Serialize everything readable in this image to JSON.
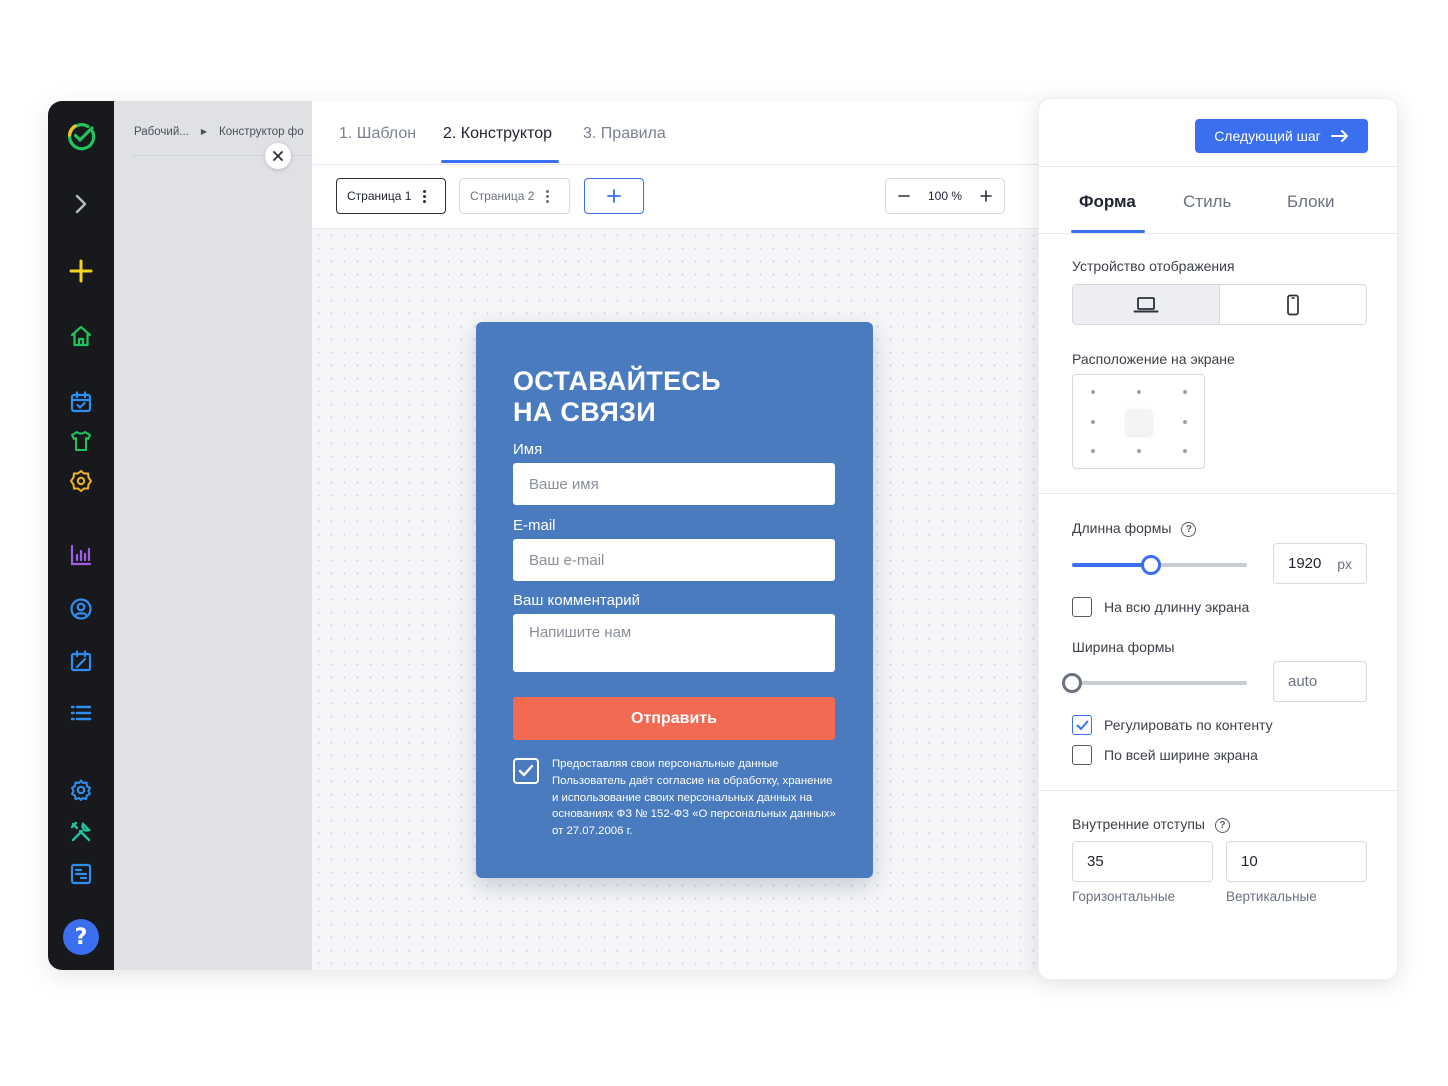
{
  "breadcrumbs": [
    "Рабочий...",
    "Конструктор фо"
  ],
  "steps": [
    {
      "label": "1. Шаблон",
      "active": false
    },
    {
      "label": "2. Конструктор",
      "active": true
    },
    {
      "label": "3. Правила",
      "active": false
    }
  ],
  "toolbar": {
    "pages": [
      "Страница 1",
      "Страница 2"
    ],
    "add_label": "+",
    "zoom": "100 %",
    "zoom_out": "−",
    "zoom_in": "+"
  },
  "form": {
    "title_line1": "ОСТАВАЙТЕСЬ",
    "title_line2": "НА СВЯЗИ",
    "fields": [
      {
        "label": "Имя",
        "placeholder": "Ваше имя"
      },
      {
        "label": "E-mail",
        "placeholder": "Ваш e-mail"
      },
      {
        "label": "Ваш комментарий",
        "placeholder": "Напишите нам"
      }
    ],
    "submit_label": "Отправить",
    "consent_checked": true,
    "consent_text": "Предоставляя свои персональные данные Пользователь даёт согласие на обработку, хранение и использование своих персональных данных на основаниях ФЗ № 152-ФЗ «О персональных данных» от 27.07.2006 г.",
    "colors": {
      "background": "#4a7bbf",
      "button": "#f36a52"
    }
  },
  "panel": {
    "next_label": "Следующий шаг",
    "tabs": [
      {
        "label": "Форма",
        "active": true
      },
      {
        "label": "Стиль",
        "active": false
      },
      {
        "label": "Блоки",
        "active": false
      }
    ],
    "device_label": "Устройство отображения",
    "device_selected": "desktop",
    "position_label": "Расположение на экране",
    "position_selected": "center",
    "length": {
      "label": "Длинна формы",
      "value": "1920",
      "unit": "px",
      "slider_fraction": 0.45
    },
    "full_length_label": "На всю длинну экрана",
    "full_length_checked": false,
    "width": {
      "label": "Ширина формы",
      "value": "auto",
      "slider_fraction": 0.0
    },
    "fit_content_label": "Регулировать по контенту",
    "fit_content_checked": true,
    "full_width_label": "По всей ширине экрана",
    "full_width_checked": false,
    "padding": {
      "label": "Внутренние отступы",
      "horizontal_value": "35",
      "vertical_value": "10",
      "horizontal_label": "Горизонтальные",
      "vertical_label": "Вертикальные"
    }
  },
  "sidebar_icons": [
    "logo-icon",
    "chevron-right-icon",
    "plus-icon",
    "home-icon",
    "calendar-check-icon",
    "shirt-icon",
    "settings-badge-icon",
    "bar-chart-icon",
    "user-circle-icon",
    "calendar-edit-icon",
    "list-icon",
    "gear-icon",
    "tools-icon",
    "layout-icon",
    "help-icon"
  ],
  "accent_color": "#3a6ff0"
}
